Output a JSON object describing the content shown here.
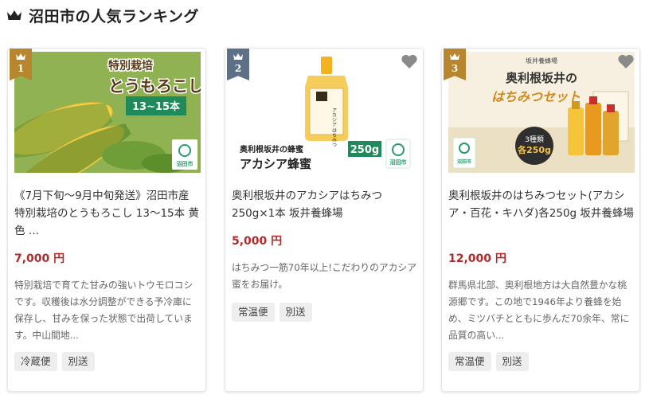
{
  "section": {
    "title": "沼田市の人気ランキング"
  },
  "colors": {
    "gold": "#b8862f",
    "silver": "#5d7088",
    "price": "#b22a2a"
  },
  "products": [
    {
      "rank": "1",
      "image": {
        "headline1": "特別栽培",
        "headline2": "とうもろこし",
        "badge": "13~15本",
        "logo": "沼田市",
        "logo_sub": "ふるさと納税"
      },
      "title": "《7月下旬～9月中旬発送》沼田市産 特別栽培のとうもろこし 13～15本 黄色 …",
      "price": "7,000 円",
      "description": "特別栽培で育てた甘みの強いトウモロコシです。収穫後は水分調整ができる予冷庫に保存し、甘みを保った状態で出荷しています。中山間地...",
      "tags": [
        "冷蔵便",
        "別送"
      ]
    },
    {
      "rank": "2",
      "image": {
        "caption_small": "奥利根坂井の蜂蜜",
        "caption_big": "アカシア蜂蜜",
        "weight": "250g",
        "jar_label": "アカシア はちみつ",
        "logo": "沼田市"
      },
      "title": "奥利根坂井のアカシアはちみつ 250g×1本 坂井養蜂場",
      "price": "5,000 円",
      "description": "はちみつ一筋70年以上!こだわりのアカシア蜜をお届け。",
      "tags": [
        "常温便",
        "別送"
      ]
    },
    {
      "rank": "3",
      "image": {
        "brand": "坂井養蜂場",
        "line1": "奥利根坂井の",
        "line2": "はちみつセット",
        "badge_top": "3種類",
        "badge_bottom": "各250g",
        "logo": "沼田市"
      },
      "title": "奥利根坂井のはちみつセット(アカシア・百花・キハダ)各250g 坂井養蜂場",
      "price": "12,000 円",
      "description": "群馬県北部、奥利根地方は大自然豊かな桃源郷です。この地で1946年より養蜂を始め、ミツバチとともに歩んだ70余年、常に品質の高い...",
      "tags": [
        "常温便",
        "別送"
      ]
    }
  ]
}
